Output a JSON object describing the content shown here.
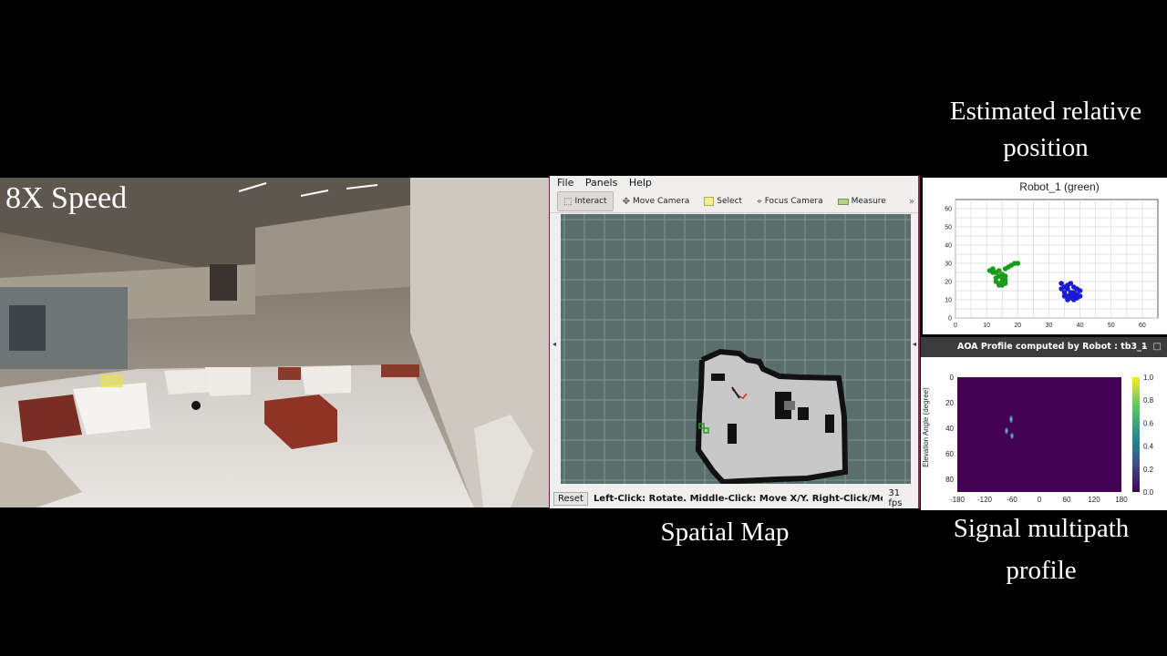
{
  "overlay": {
    "speed": "8X Speed"
  },
  "captions": {
    "estimated_line1": "Estimated relative",
    "estimated_line2": "position",
    "spatial_map": "Spatial Map",
    "signal_line1": "Signal multipath",
    "signal_line2": "profile"
  },
  "rviz": {
    "menu": [
      "File",
      "Panels",
      "Help"
    ],
    "tools": [
      {
        "label": "Interact",
        "icon": "interact-icon",
        "active": true
      },
      {
        "label": "Move Camera",
        "icon": "move-camera-icon"
      },
      {
        "label": "Select",
        "icon": "select-icon"
      },
      {
        "label": "Focus Camera",
        "icon": "focus-camera-icon"
      },
      {
        "label": "Measure",
        "icon": "measure-icon"
      }
    ],
    "more": "»",
    "status": {
      "reset": "Reset",
      "hint": "Left-Click: Rotate. Middle-Click: Move X/Y. Right-Click/Mouse Whe",
      "fps": "31 fps"
    },
    "colors": {
      "grid_bg": "#5a6e6c",
      "map_free": "#c8c8c8",
      "map_wall": "#111111"
    }
  },
  "scatter": {
    "title": "Robot_1 (green)",
    "xticks": [
      "0",
      "10",
      "20",
      "30",
      "40",
      "50",
      "60"
    ],
    "yticks": [
      "0",
      "10",
      "20",
      "30",
      "40",
      "50",
      "60"
    ],
    "colors": {
      "green": "#1a9a1a",
      "blue": "#1a1ad0"
    }
  },
  "aoa": {
    "window_title": "AOA Profile computed by Robot : tb3_1",
    "ylabel": "Elevation Angle (degree)",
    "xticks": [
      "-180",
      "-120",
      "-60",
      "0",
      "60",
      "120",
      "180"
    ],
    "yticks": [
      "0",
      "20",
      "40",
      "60",
      "80"
    ],
    "cbar_ticks": [
      "1.0",
      "0.8",
      "0.6",
      "0.4",
      "0.2",
      "0.0"
    ]
  },
  "chart_data": [
    {
      "type": "scatter",
      "title": "Robot_1 (green)",
      "xlim": [
        0,
        65
      ],
      "ylim": [
        0,
        65
      ],
      "series": [
        {
          "color": "green",
          "points": [
            [
              11,
              26
            ],
            [
              12,
              27
            ],
            [
              13,
              25
            ],
            [
              14,
              26
            ],
            [
              15,
              24
            ],
            [
              16,
              27
            ],
            [
              17,
              28
            ],
            [
              18,
              29
            ],
            [
              19,
              30
            ],
            [
              20,
              30
            ],
            [
              13,
              20
            ],
            [
              14,
              19
            ],
            [
              15,
              20
            ],
            [
              16,
              19
            ],
            [
              13,
              22
            ],
            [
              14,
              23
            ],
            [
              15,
              22
            ],
            [
              16,
              23
            ],
            [
              14,
              18
            ],
            [
              15,
              18
            ],
            [
              16,
              21
            ],
            [
              12,
              25
            ]
          ]
        },
        {
          "color": "blue",
          "points": [
            [
              34,
              19
            ],
            [
              35,
              17
            ],
            [
              36,
              16
            ],
            [
              37,
              14
            ],
            [
              38,
              12
            ],
            [
              39,
              13
            ],
            [
              40,
              15
            ],
            [
              36,
              12
            ],
            [
              37,
              11
            ],
            [
              38,
              14
            ],
            [
              35,
              14
            ],
            [
              36,
              18
            ],
            [
              37,
              19
            ],
            [
              38,
              17
            ],
            [
              39,
              16
            ],
            [
              34,
              16
            ],
            [
              37,
              13
            ],
            [
              38,
              10
            ],
            [
              36,
              10
            ],
            [
              35,
              12
            ],
            [
              39,
              11
            ],
            [
              40,
              12
            ]
          ]
        }
      ]
    },
    {
      "type": "heatmap",
      "title": "AOA Profile computed by Robot : tb3_1",
      "xlim": [
        -180,
        180
      ],
      "ylim": [
        0,
        90
      ],
      "ylabel": "Elevation Angle (degree)",
      "colorbar": [
        0.0,
        1.0
      ],
      "hotspots": [
        {
          "x": -62,
          "y": 33,
          "value": 0.7
        },
        {
          "x": -72,
          "y": 42,
          "value": 0.55
        },
        {
          "x": -60,
          "y": 46,
          "value": 0.5
        }
      ]
    }
  ]
}
